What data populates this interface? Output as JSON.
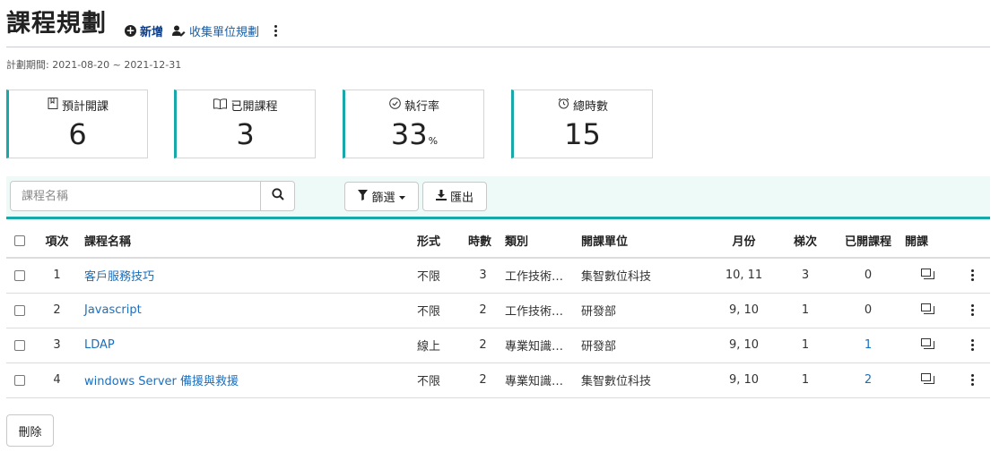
{
  "header": {
    "title": "課程規劃",
    "add_label": "新增",
    "collect_label": "收集單位規劃"
  },
  "period": "計劃期間: 2021-08-20 ~ 2021-12-31",
  "stats": [
    {
      "label": "預計開課",
      "value": "6",
      "unit": "",
      "icon": "bookmark-icon"
    },
    {
      "label": "已開課程",
      "value": "3",
      "unit": "",
      "icon": "open-book-icon"
    },
    {
      "label": "執行率",
      "value": "33",
      "unit": "%",
      "icon": "check-circle-icon"
    },
    {
      "label": "總時數",
      "value": "15",
      "unit": "",
      "icon": "alarm-clock-icon"
    }
  ],
  "toolbar": {
    "search_placeholder": "課程名稱",
    "filter_label": "篩選",
    "export_label": "匯出"
  },
  "table": {
    "headers": [
      "項次",
      "課程名稱",
      "形式",
      "時數",
      "類別",
      "開課單位",
      "月份",
      "梯次",
      "已開課程",
      "開課"
    ],
    "rows": [
      {
        "index": "1",
        "name": "客戶服務技巧",
        "form": "不限",
        "hours": "3",
        "category": "工作技術…",
        "unit": "集智數位科技",
        "months": "10, 11",
        "batches": "3",
        "opened": "0",
        "opened_link": false
      },
      {
        "index": "2",
        "name": "Javascript",
        "form": "不限",
        "hours": "2",
        "category": "工作技術…",
        "unit": "研發部",
        "months": "9, 10",
        "batches": "1",
        "opened": "0",
        "opened_link": false
      },
      {
        "index": "3",
        "name": "LDAP",
        "form": "線上",
        "hours": "2",
        "category": "專業知識…",
        "unit": "研發部",
        "months": "9, 10",
        "batches": "1",
        "opened": "1",
        "opened_link": true
      },
      {
        "index": "4",
        "name": "windows Server 備援與救援",
        "form": "不限",
        "hours": "2",
        "category": "專業知識…",
        "unit": "集智數位科技",
        "months": "9, 10",
        "batches": "1",
        "opened": "2",
        "opened_link": true
      }
    ]
  },
  "delete_label": "刪除",
  "colors": {
    "accent": "#17a9a9",
    "link": "#1a6fbf",
    "toolbar_bg": "#eefaf7"
  }
}
